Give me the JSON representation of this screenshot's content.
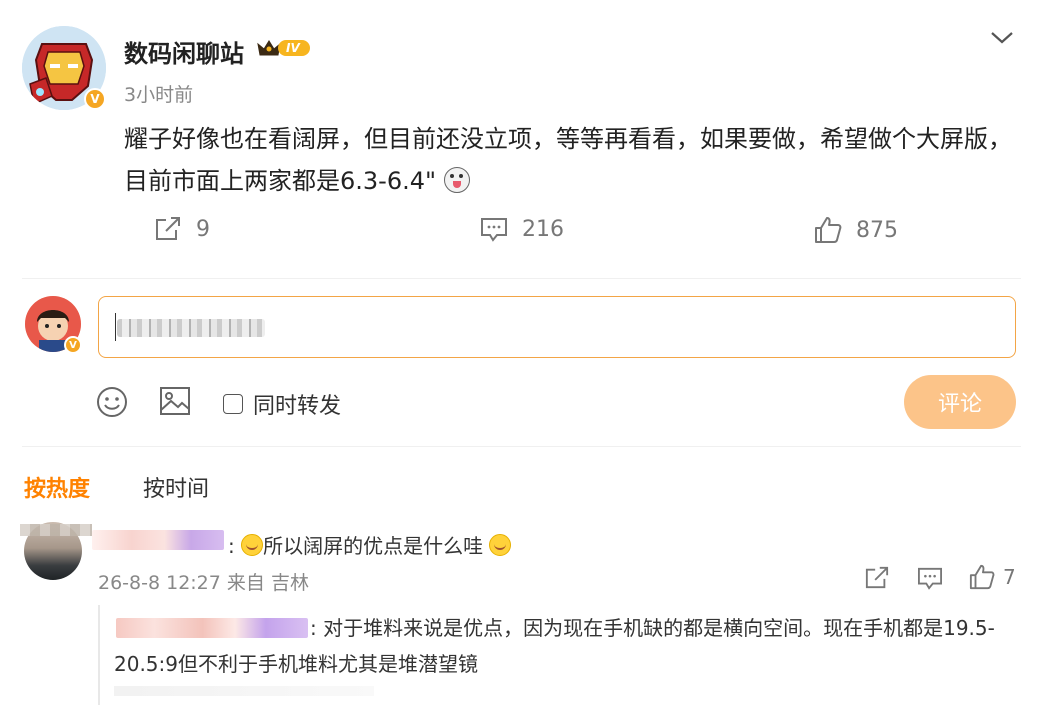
{
  "post": {
    "author": "数码闲聊站",
    "level_badge": "IV",
    "time": "3小时前",
    "text": "耀子好像也在看阔屏，但目前还没立项，等等再看看，如果要做，希望做个大屏版，目前市面上两家都是6.3-6.4\"",
    "actions": {
      "share_count": "9",
      "comment_count": "216",
      "like_count": "875"
    }
  },
  "composer": {
    "forward_label": "同时转发",
    "submit_label": "评论"
  },
  "sort_tabs": {
    "hot": "按热度",
    "time": "按时间"
  },
  "comments": [
    {
      "text": "所以阔屏的优点是什么哇",
      "date": "26-8-8 12:27",
      "location": "来自 吉林",
      "like_count": "7",
      "reply": {
        "text": ": 对于堆料来说是优点，因为现在手机缺的都是横向空间。现在手机都是19.5-20.5:9但不利于手机堆料尤其是堆潜望镜"
      }
    }
  ],
  "colors": {
    "accent": "#ff8200",
    "input_border": "#f3a546",
    "submit_bg": "#fcc489",
    "badge": "#f5a623"
  },
  "icons": [
    "chevron-down-icon",
    "share-icon",
    "comment-icon",
    "like-icon",
    "emoji-icon",
    "image-icon",
    "checkbox-icon"
  ]
}
